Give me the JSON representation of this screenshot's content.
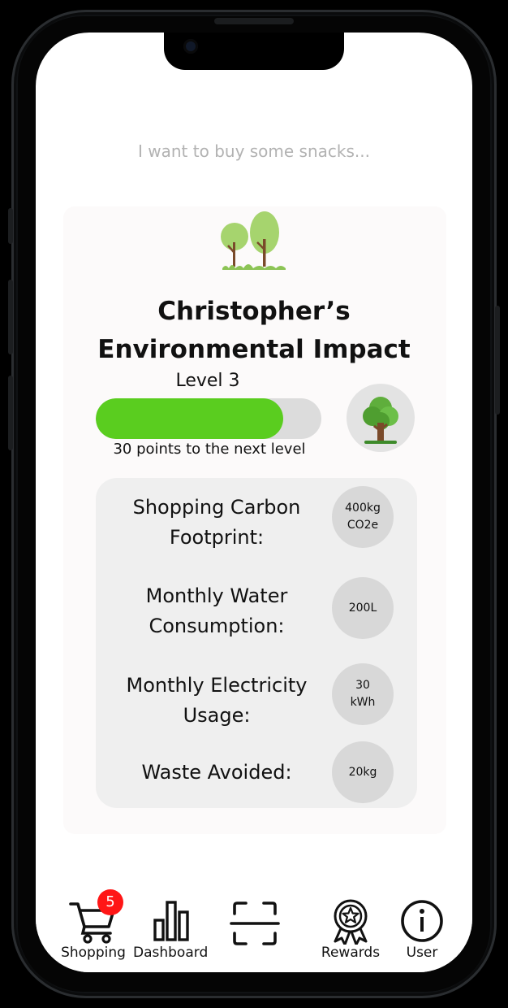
{
  "search": {
    "placeholder": "I want to buy some snacks..."
  },
  "impact": {
    "title_line1": "Christopher’s",
    "title_line2": "Environmental Impact",
    "level_label": "Level 3",
    "progress_fraction": 0.83,
    "progress_caption": "30 points to the next level",
    "illustration_icon": "trees-icon",
    "badge_icon": "tree-icon"
  },
  "stats": [
    {
      "label_line1": "Shopping Carbon",
      "label_line2": "Footprint:",
      "value_line1": "400kg",
      "value_line2": "CO2e"
    },
    {
      "label_line1": "Monthly Water",
      "label_line2": "Consumption:",
      "value_line1": "200L",
      "value_line2": ""
    },
    {
      "label_line1": "Monthly Electricity",
      "label_line2": "Usage:",
      "value_line1": "30",
      "value_line2": "kWh"
    },
    {
      "label_line1": "Waste Avoided:",
      "label_line2": "",
      "value_line1": "20kg",
      "value_line2": ""
    }
  ],
  "nav": {
    "shopping": {
      "label": "Shopping",
      "badge": "5",
      "icon": "cart-icon"
    },
    "dashboard": {
      "label": "Dashboard",
      "icon": "bar-chart-icon"
    },
    "scan": {
      "label": "",
      "icon": "scan-icon"
    },
    "rewards": {
      "label": "Rewards",
      "icon": "award-icon"
    },
    "user": {
      "label": "User",
      "icon": "info-icon"
    }
  },
  "colors": {
    "progress": "#5acd1f",
    "badge": "#ff1616",
    "bubble": "#d8d8d8"
  }
}
